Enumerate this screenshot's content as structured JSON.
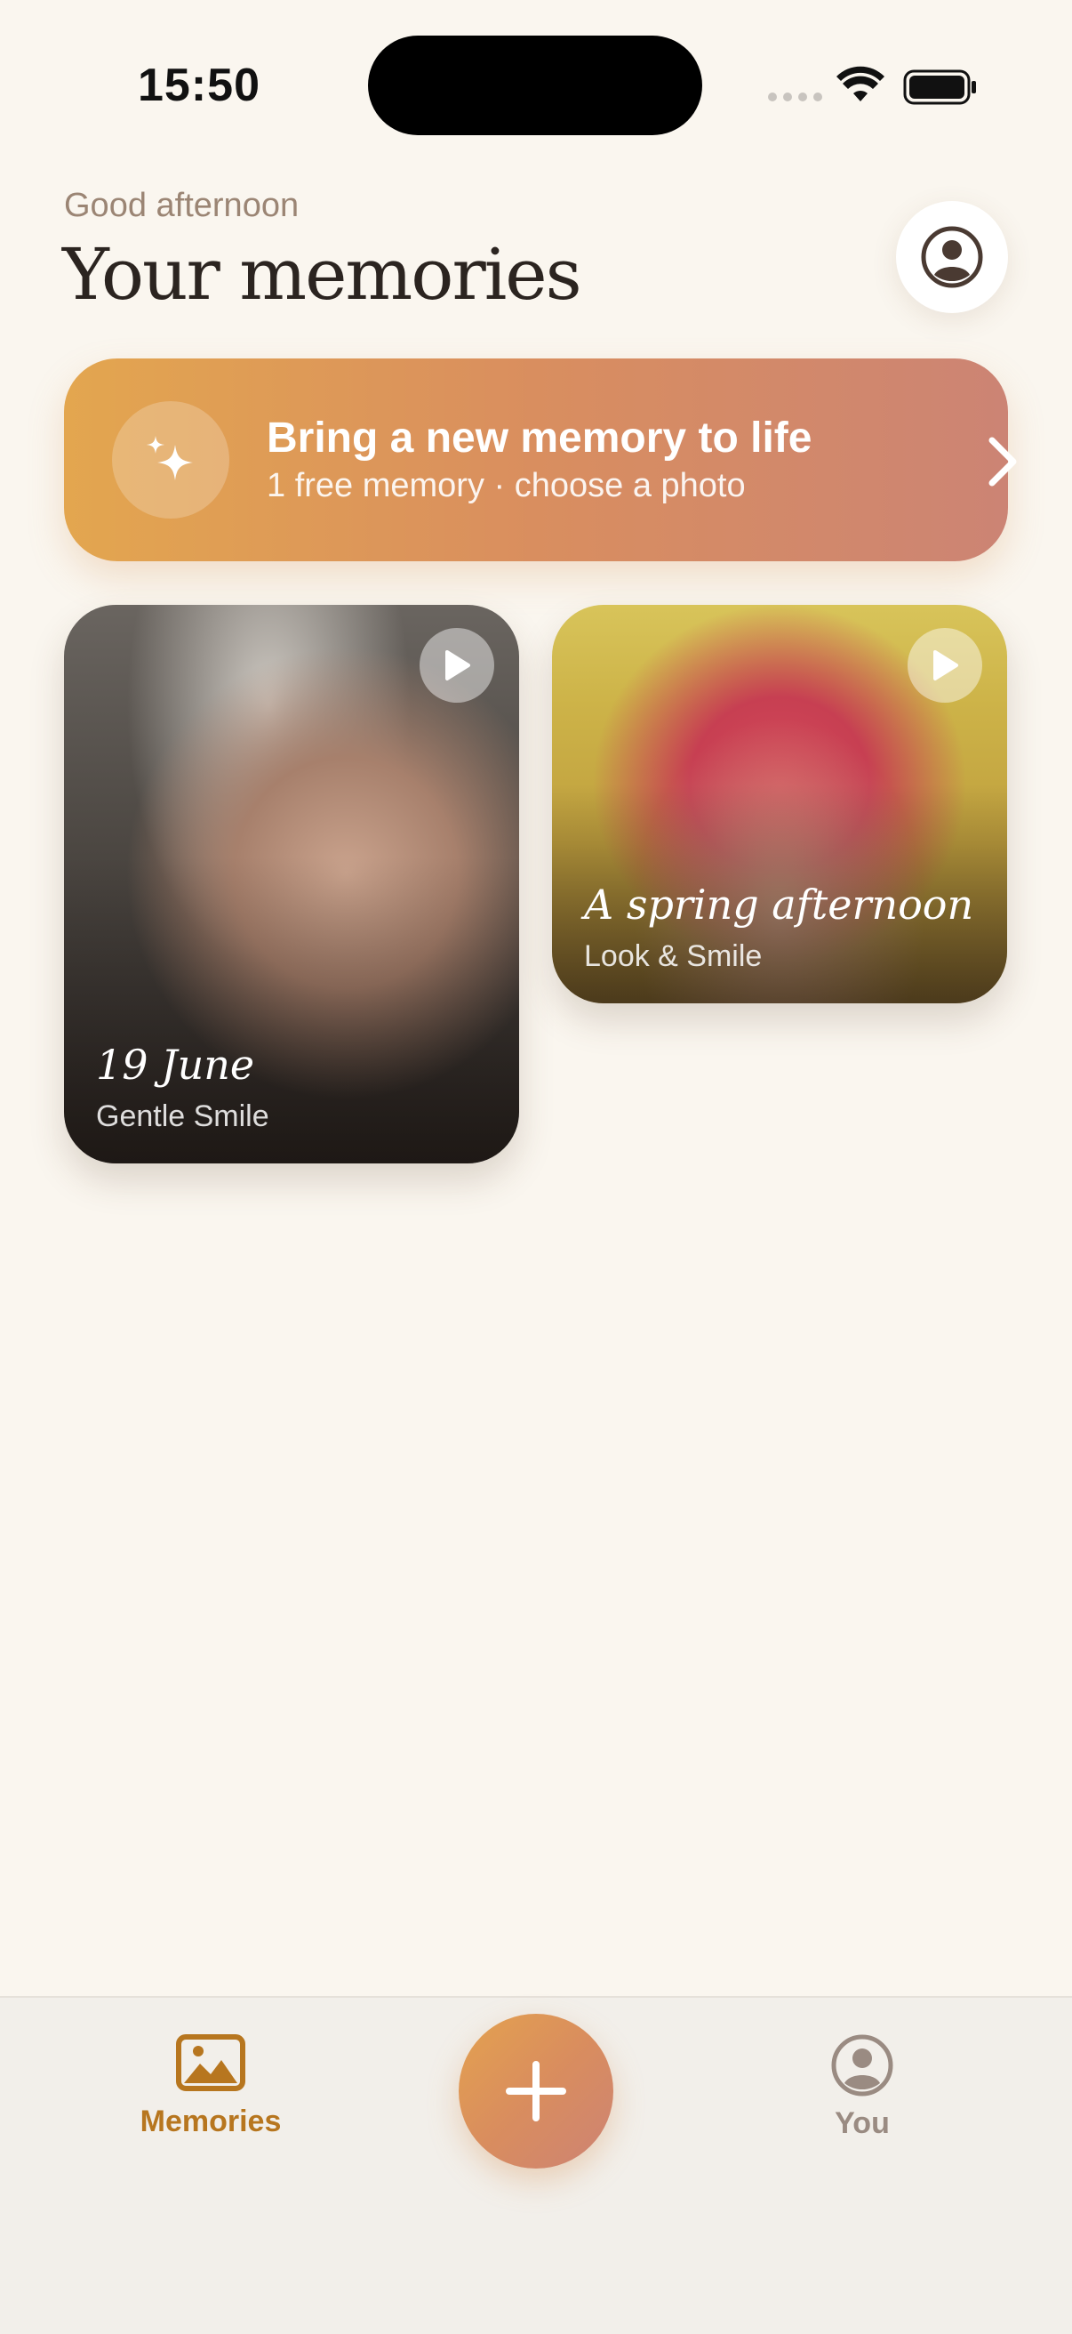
{
  "status_bar": {
    "time": "15:50"
  },
  "header": {
    "greeting": "Good afternoon",
    "title": "Your memories"
  },
  "banner": {
    "title": "Bring a new memory to life",
    "subtitle": "1 free memory · choose a photo",
    "icon": "sparkles-icon"
  },
  "memories": [
    {
      "title": "19 June",
      "style": "Gentle Smile"
    },
    {
      "title": "A spring afternoon",
      "style": "Look & Smile"
    }
  ],
  "tabbar": {
    "memories_label": "Memories",
    "you_label": "You"
  },
  "colors": {
    "accent": "#b7761f",
    "gradient_start": "#e3a64f",
    "gradient_end": "#cc8474",
    "background": "#faf6ef"
  }
}
